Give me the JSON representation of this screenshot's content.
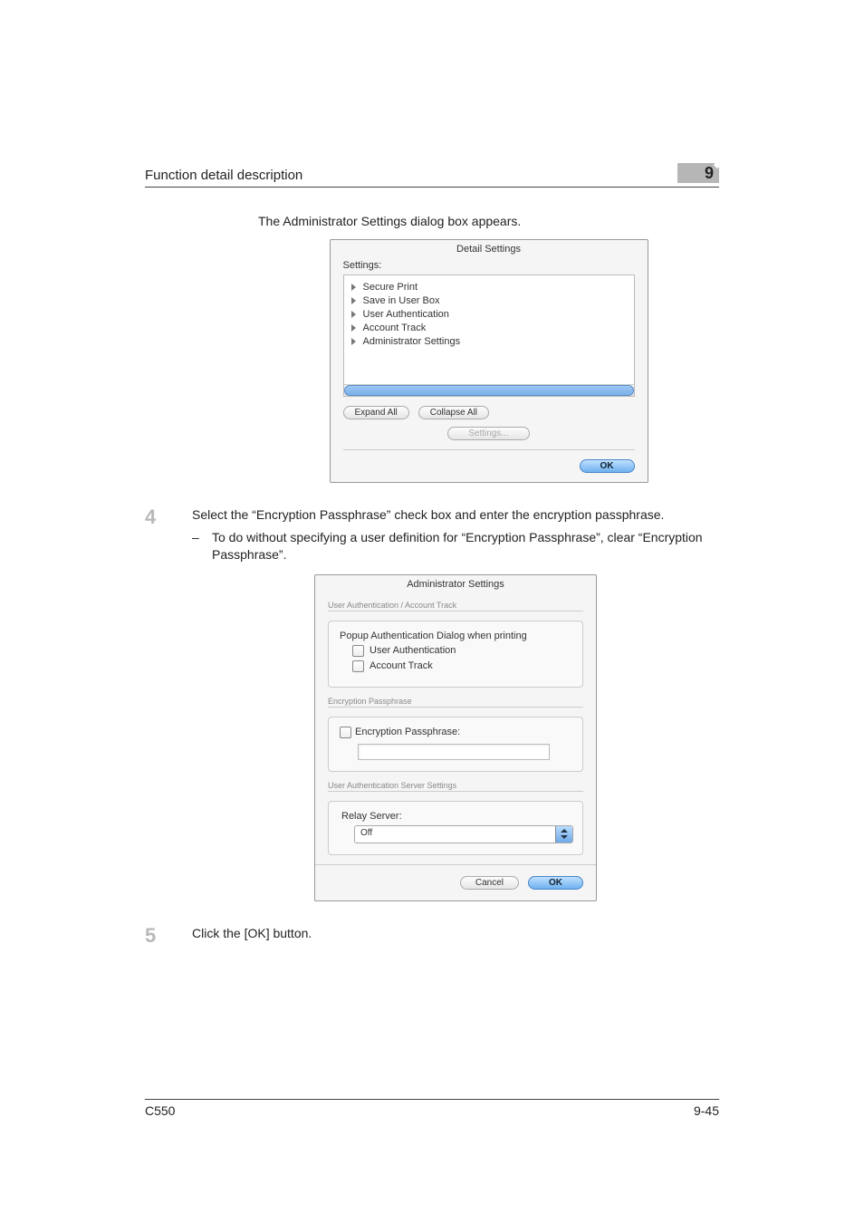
{
  "header": {
    "title": "Function detail description",
    "chapter": "9"
  },
  "intro": "The Administrator Settings dialog box appears.",
  "dialog1": {
    "title": "Detail Settings",
    "settings_label": "Settings:",
    "tree": [
      "Secure Print",
      "Save in User Box",
      "User Authentication",
      "Account Track",
      "Administrator Settings"
    ],
    "expand": "Expand All",
    "collapse": "Collapse All",
    "settings_btn": "Settings...",
    "ok": "OK"
  },
  "step4": {
    "num": "4",
    "text": "Select the “Encryption Passphrase” check box and enter the encryption passphrase.",
    "sub_dash": "–",
    "sub_text": "To do without specifying a user definition for “Encryption Passphrase”, clear “Encryption Passphrase”."
  },
  "dialog2": {
    "title": "Administrator Settings",
    "tab": "User Authentication / Account Track",
    "popup_label": "Popup Authentication Dialog when printing",
    "user_auth": "User Authentication",
    "account_track": "Account Track",
    "enc_section": "Encryption Passphrase",
    "enc_chk": "Encryption Passphrase:",
    "server_section": "User Authentication Server Settings",
    "relay_label": "Relay Server:",
    "relay_value": "Off",
    "cancel": "Cancel",
    "ok": "OK"
  },
  "step5": {
    "num": "5",
    "text": "Click the [OK] button."
  },
  "footer": {
    "model": "C550",
    "page": "9-45"
  }
}
